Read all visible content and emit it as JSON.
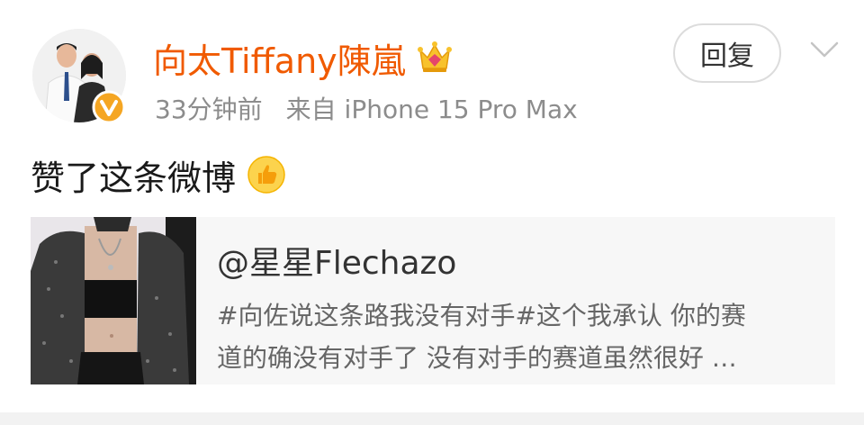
{
  "post": {
    "author": {
      "name": "向太Tiffany陳嵐",
      "avatar_icon": "avatar-photo",
      "verified_icon": "verified-v-icon",
      "membership_icon": "crown-icon"
    },
    "meta": {
      "time": "33分钟前",
      "source": "来自 iPhone 15 Pro Max"
    },
    "actions": {
      "reply_label": "回复",
      "more_icon": "chevron-down-icon"
    },
    "text": "赞了这条微博",
    "text_icon": "thumbs-up-icon",
    "embed": {
      "author": "@星星Flechazo",
      "lines": [
        "#向佐说这条路我没有对手#这个我承认  你的赛",
        "道的确没有对手了  没有对手的赛道虽然很好 …"
      ]
    }
  },
  "colors": {
    "username": "#f05a00",
    "meta": "#8c8c8c",
    "verified_badge": "#f5a623",
    "card_background": "#f7f7f7"
  }
}
